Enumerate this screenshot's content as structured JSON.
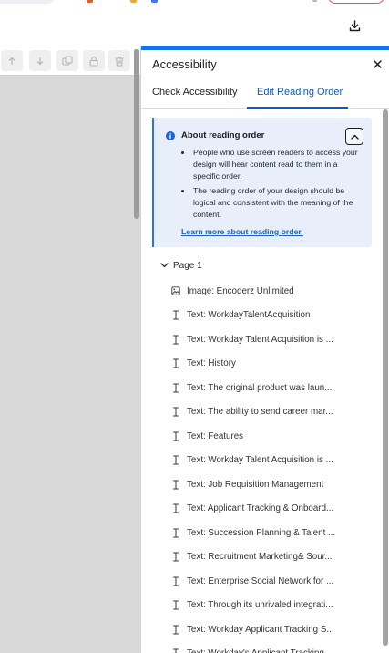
{
  "panel": {
    "title": "Accessibility",
    "close_icon": "close-icon"
  },
  "tabs": [
    {
      "label": "Check Accessibility",
      "active": false
    },
    {
      "label": "Edit Reading Order",
      "active": true
    }
  ],
  "info": {
    "title": "About reading order",
    "bullets": [
      "People who use screen readers to access your design will hear content read to them in a specific order.",
      "The reading order of your design should be logical and consistent with the meaning of the content."
    ],
    "link": "Learn more about reading order."
  },
  "tree": {
    "page_label": "Page 1",
    "items": [
      {
        "icon": "image-icon",
        "label": "Image: Encoderz Unlimited"
      },
      {
        "icon": "text-cursor-icon",
        "label": "Text: WorkdayTalentAcquisition"
      },
      {
        "icon": "text-cursor-icon",
        "label": "Text: Workday Talent Acquisition is ..."
      },
      {
        "icon": "text-cursor-icon",
        "label": "Text: History"
      },
      {
        "icon": "text-cursor-icon",
        "label": "Text: The original product was laun..."
      },
      {
        "icon": "text-cursor-icon",
        "label": "Text: The ability to send career mar..."
      },
      {
        "icon": "text-cursor-icon",
        "label": "Text: Features"
      },
      {
        "icon": "text-cursor-icon",
        "label": "Text: Workday Talent Acquisition is ..."
      },
      {
        "icon": "text-cursor-icon",
        "label": "Text: Job Requisition Management"
      },
      {
        "icon": "text-cursor-icon",
        "label": "Text: Applicant Tracking & Onboard..."
      },
      {
        "icon": "text-cursor-icon",
        "label": "Text: Succession Planning & Talent ..."
      },
      {
        "icon": "text-cursor-icon",
        "label": "Text: Recruitment Marketing& Sour..."
      },
      {
        "icon": "text-cursor-icon",
        "label": "Text: Enterprise Social Network for ..."
      },
      {
        "icon": "text-cursor-icon",
        "label": "Text: Through its unrivaled integrati..."
      },
      {
        "icon": "text-cursor-icon",
        "label": "Text: Workday Applicant Tracking S..."
      },
      {
        "icon": "text-cursor-icon",
        "label": "Text: Workday's Applicant Tracking ..."
      }
    ]
  },
  "toolbar": {
    "buttons": [
      "move-up-icon",
      "move-down-icon",
      "duplicate-icon",
      "lock-icon",
      "trash-icon"
    ]
  },
  "colors": {
    "accent": "#1473e6",
    "info_bg": "#e8effb",
    "link": "#1d5fbf"
  }
}
